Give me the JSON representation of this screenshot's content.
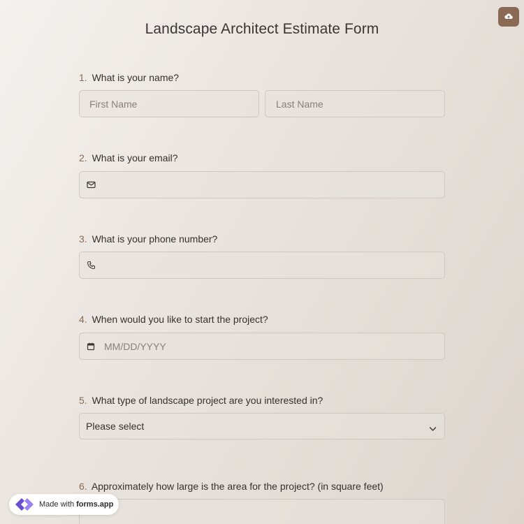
{
  "form": {
    "title": "Landscape Architect Estimate Form",
    "upload_icon": "cloud-upload-icon"
  },
  "questions": [
    {
      "number": "1.",
      "label": "What is your name?",
      "fields": [
        {
          "placeholder": "First Name"
        },
        {
          "placeholder": "Last Name"
        }
      ]
    },
    {
      "number": "2.",
      "label": "What is your email?",
      "icon": "envelope-icon",
      "value": ""
    },
    {
      "number": "3.",
      "label": "What is your phone number?",
      "icon": "phone-icon",
      "value": ""
    },
    {
      "number": "4.",
      "label": "When would you like to start the project?",
      "icon": "calendar-icon",
      "placeholder": "MM/DD/YYYY"
    },
    {
      "number": "5.",
      "label": "What type of landscape project are you interested in?",
      "selected": "Please select",
      "icon": "chevron-down-icon"
    },
    {
      "number": "6.",
      "label": "Approximately how large is the area for the project? (in square feet)"
    }
  ],
  "badge": {
    "prefix": "Made with",
    "brand": "forms.app",
    "icon": "forms-app-logo-icon"
  },
  "colors": {
    "accent": "#8a6a55",
    "field_border": "#cfc6bf",
    "text": "#33302d"
  }
}
